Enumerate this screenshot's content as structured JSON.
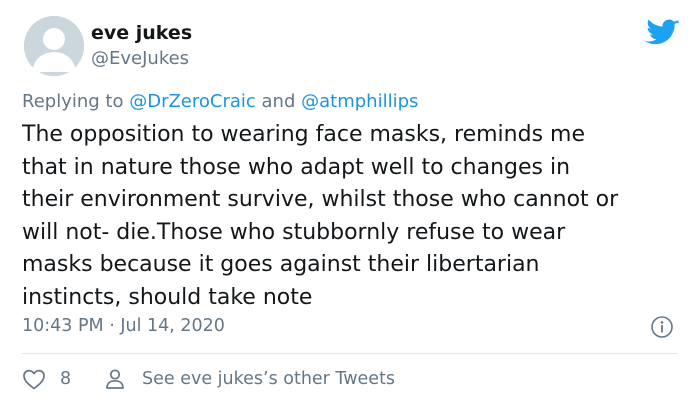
{
  "author": {
    "display_name": "eve jukes",
    "handle": "@EveJukes"
  },
  "reply": {
    "prefix": "Replying to ",
    "mention1": "@DrZeroCraic",
    "joiner": " and ",
    "mention2": "@atmphillips"
  },
  "tweet": {
    "text": "The opposition to wearing face masks, reminds me\nthat in nature those who adapt well to changes in\ntheir environment survive, whilst those who cannot or\nwill not- die.Those  who  stubbornly refuse to wear\nmasks because it goes against their libertarian\ninstincts, should take note",
    "timestamp": "10:43 PM · Jul 14, 2020"
  },
  "actions": {
    "like_count": "8",
    "other_tweets_label": "See eve jukes’s other Tweets"
  },
  "colors": {
    "text": "#14171a",
    "secondary": "#657786",
    "accent": "#1b95e0",
    "divider": "#e1e8ed"
  },
  "icons": {
    "brand": "twitter-bird-icon",
    "info": "info-icon",
    "like": "heart-icon",
    "profile": "person-icon"
  }
}
